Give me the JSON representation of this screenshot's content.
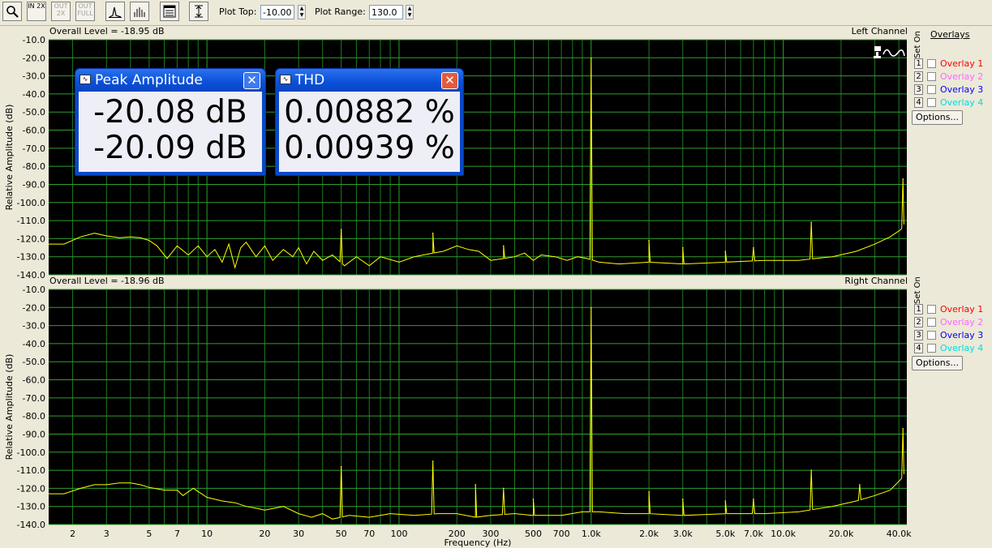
{
  "toolbar": {
    "zoom_icon": "magnifier-icon",
    "in2x_label": "IN 2X",
    "out2x_label": "OUT 2X",
    "outfull_label": "OUT FULL",
    "plot_top_label": "Plot Top:",
    "plot_top_value": "-10.00",
    "plot_range_label": "Plot Range:",
    "plot_range_value": "130.0"
  },
  "overlays": {
    "title": "Overlays",
    "set_label": "Set",
    "on_label": "On",
    "items": [
      {
        "num": "1",
        "name": "Overlay 1",
        "color": "#ff0000"
      },
      {
        "num": "2",
        "name": "Overlay 2",
        "color": "#ff66ff"
      },
      {
        "num": "3",
        "name": "Overlay 3",
        "color": "#0000ff"
      },
      {
        "num": "4",
        "name": "Overlay 4",
        "color": "#00dddd"
      }
    ],
    "options_label": "Options..."
  },
  "meters": {
    "peak": {
      "title": "Peak Amplitude",
      "left": "-20.08 dB",
      "right": "-20.09 dB"
    },
    "thd": {
      "title": "THD",
      "left": "0.00882 %",
      "right": "0.00939 %"
    }
  },
  "chart_data": [
    {
      "type": "line",
      "title": "Left Channel",
      "subtitle": "Overall Level = -18.95 dB",
      "ylabel": "Relative Amplitude (dB)",
      "xlabel": "",
      "xscale": "log",
      "xlim": [
        1.5,
        44000
      ],
      "ylim": [
        -140,
        -10
      ],
      "yticks": [
        "-10.0",
        "-20.0",
        "-30.0",
        "-40.0",
        "-50.0",
        "-60.0",
        "-70.0",
        "-80.0",
        "-90.0",
        "-100.0",
        "-110.0",
        "-120.0",
        "-130.0",
        "-140.0"
      ],
      "grid": true,
      "color": "#ffff00",
      "noise": [
        [
          1.5,
          -123
        ],
        [
          1.8,
          -123
        ],
        [
          2.2,
          -119
        ],
        [
          2.6,
          -117
        ],
        [
          3,
          -118.5
        ],
        [
          3.5,
          -119.5
        ],
        [
          4,
          -119
        ],
        [
          4.5,
          -119.5
        ],
        [
          5,
          -121
        ],
        [
          5.5,
          -124
        ],
        [
          6.2,
          -131
        ],
        [
          7,
          -124
        ],
        [
          8,
          -129
        ],
        [
          9,
          -124
        ],
        [
          10,
          -130
        ],
        [
          11,
          -126
        ],
        [
          12,
          -133
        ],
        [
          13,
          -123
        ],
        [
          14,
          -136
        ],
        [
          15,
          -125
        ],
        [
          16,
          -122
        ],
        [
          18,
          -130
        ],
        [
          20,
          -124
        ],
        [
          22,
          -132
        ],
        [
          25,
          -126
        ],
        [
          28,
          -130
        ],
        [
          30,
          -125
        ],
        [
          33,
          -134
        ],
        [
          36,
          -127
        ],
        [
          40,
          -132
        ],
        [
          45,
          -129
        ],
        [
          52,
          -135
        ],
        [
          60,
          -130
        ],
        [
          70,
          -135
        ],
        [
          80,
          -130
        ],
        [
          100,
          -133
        ],
        [
          120,
          -130
        ],
        [
          150,
          -128
        ],
        [
          170,
          -127
        ],
        [
          200,
          -124
        ],
        [
          230,
          -126
        ],
        [
          260,
          -127
        ],
        [
          300,
          -132
        ],
        [
          350,
          -131
        ],
        [
          400,
          -130
        ],
        [
          450,
          -128
        ],
        [
          500,
          -132
        ],
        [
          550,
          -129
        ],
        [
          650,
          -130
        ],
        [
          750,
          -132
        ],
        [
          850,
          -130
        ],
        [
          950,
          -131
        ],
        [
          1100,
          -133
        ],
        [
          1400,
          -134
        ],
        [
          2000,
          -133
        ],
        [
          3000,
          -134
        ],
        [
          5000,
          -133
        ],
        [
          8000,
          -132
        ],
        [
          12000,
          -132
        ],
        [
          18000,
          -130
        ],
        [
          24000,
          -127
        ],
        [
          30000,
          -123
        ],
        [
          36000,
          -119
        ],
        [
          41000,
          -115
        ],
        [
          42500,
          -112
        ]
      ],
      "peaks": [
        [
          50,
          -115
        ],
        [
          150,
          -117
        ],
        [
          350,
          -124
        ],
        [
          1000,
          -20.1
        ],
        [
          2000,
          -121
        ],
        [
          3000,
          -125
        ],
        [
          5000,
          -127
        ],
        [
          7000,
          -125
        ],
        [
          14000,
          -111
        ],
        [
          42000,
          -87
        ]
      ]
    },
    {
      "type": "line",
      "title": "Right Channel",
      "subtitle": "Overall Level = -18.96 dB",
      "ylabel": "Relative Amplitude (dB)",
      "xlabel": "Frequency (Hz)",
      "xscale": "log",
      "xlim": [
        1.5,
        44000
      ],
      "ylim": [
        -140,
        -10
      ],
      "xticks": [
        "2",
        "3",
        "5",
        "7",
        "10",
        "20",
        "30",
        "50",
        "70",
        "100",
        "200",
        "300",
        "500",
        "700",
        "1.0k",
        "2.0k",
        "3.0k",
        "5.0k",
        "7.0k",
        "10.0k",
        "20.0k",
        "40.0k"
      ],
      "yticks": [
        "-10.0",
        "-20.0",
        "-30.0",
        "-40.0",
        "-50.0",
        "-60.0",
        "-70.0",
        "-80.0",
        "-90.0",
        "-100.0",
        "-110.0",
        "-120.0",
        "-130.0",
        "-140.0"
      ],
      "grid": true,
      "color": "#ffff00",
      "noise": [
        [
          1.5,
          -123
        ],
        [
          1.8,
          -123
        ],
        [
          2.2,
          -120
        ],
        [
          2.6,
          -118
        ],
        [
          3,
          -118
        ],
        [
          3.5,
          -117
        ],
        [
          4,
          -117
        ],
        [
          4.5,
          -118
        ],
        [
          5,
          -119.5
        ],
        [
          6,
          -121
        ],
        [
          7,
          -121
        ],
        [
          7.5,
          -124
        ],
        [
          8.5,
          -120
        ],
        [
          10,
          -125
        ],
        [
          12,
          -127
        ],
        [
          14,
          -128
        ],
        [
          16,
          -130
        ],
        [
          18,
          -131
        ],
        [
          20,
          -132
        ],
        [
          25,
          -130
        ],
        [
          30,
          -134
        ],
        [
          35,
          -136
        ],
        [
          40,
          -134
        ],
        [
          45,
          -137
        ],
        [
          55,
          -135
        ],
        [
          70,
          -136
        ],
        [
          90,
          -134
        ],
        [
          120,
          -135
        ],
        [
          160,
          -134
        ],
        [
          200,
          -134
        ],
        [
          250,
          -136
        ],
        [
          300,
          -135
        ],
        [
          400,
          -134
        ],
        [
          500,
          -135
        ],
        [
          700,
          -135
        ],
        [
          900,
          -133
        ],
        [
          1100,
          -133
        ],
        [
          1500,
          -134
        ],
        [
          2000,
          -134
        ],
        [
          3000,
          -135
        ],
        [
          5000,
          -134
        ],
        [
          8000,
          -134
        ],
        [
          12000,
          -133
        ],
        [
          18000,
          -130
        ],
        [
          24000,
          -127
        ],
        [
          30000,
          -124
        ],
        [
          36000,
          -121
        ],
        [
          41000,
          -115
        ],
        [
          42500,
          -112
        ]
      ],
      "peaks": [
        [
          50,
          -108
        ],
        [
          150,
          -105
        ],
        [
          250,
          -118
        ],
        [
          350,
          -120
        ],
        [
          500,
          -126
        ],
        [
          1000,
          -20.1
        ],
        [
          2000,
          -122
        ],
        [
          3000,
          -126
        ],
        [
          5000,
          -127
        ],
        [
          7000,
          -126
        ],
        [
          14000,
          -110
        ],
        [
          25000,
          -118
        ],
        [
          42000,
          -87
        ]
      ]
    }
  ]
}
